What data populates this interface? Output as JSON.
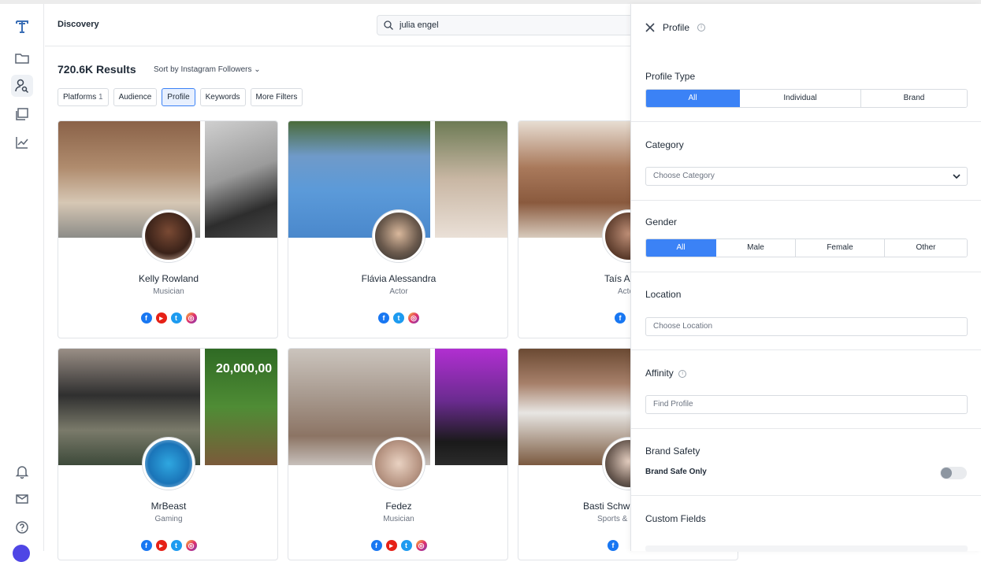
{
  "app": {
    "page_title": "Discovery",
    "search": {
      "value": "julia engel"
    }
  },
  "results": {
    "count_label": "720.6K Results",
    "sort_label": "Sort by Instagram Followers"
  },
  "filters": [
    {
      "label": "Platforms",
      "count": "1"
    },
    {
      "label": "Audience"
    },
    {
      "label": "Profile"
    },
    {
      "label": "Keywords"
    },
    {
      "label": "More Filters"
    }
  ],
  "cards": [
    {
      "name": "Kelly Rowland",
      "role": "Musician",
      "socials": [
        "facebook",
        "youtube",
        "twitter",
        "instagram"
      ]
    },
    {
      "name": "Flávia Alessandra",
      "role": "Actor",
      "socials": [
        "facebook",
        "twitter",
        "instagram"
      ]
    },
    {
      "name": "Taís Ar",
      "role": "Acto",
      "socials": [
        "facebook"
      ]
    },
    {
      "name": "MrBeast",
      "role": "Gaming",
      "socials": [
        "facebook",
        "youtube",
        "twitter",
        "instagram"
      ],
      "banner_text": "20,000,00"
    },
    {
      "name": "Fedez",
      "role": "Musician",
      "socials": [
        "facebook",
        "youtube",
        "twitter",
        "instagram"
      ]
    },
    {
      "name": "Basti Schw",
      "role": "Sports &",
      "socials": [
        "facebook"
      ]
    }
  ],
  "panel": {
    "title": "Profile",
    "profile_type": {
      "label": "Profile Type",
      "options": [
        "All",
        "Individual",
        "Brand"
      ],
      "selected": "All"
    },
    "category": {
      "label": "Category",
      "placeholder": "Choose Category"
    },
    "gender": {
      "label": "Gender",
      "options": [
        "All",
        "Male",
        "Female",
        "Other"
      ],
      "selected": "All"
    },
    "location": {
      "label": "Location",
      "placeholder": "Choose Location"
    },
    "affinity": {
      "label": "Affinity",
      "placeholder": "Find Profile"
    },
    "brand_safety": {
      "label": "Brand Safety",
      "toggle_label": "Brand Safe Only",
      "enabled": false
    },
    "custom_fields": {
      "label": "Custom Fields"
    }
  },
  "colors": {
    "accent": "#3b82f6",
    "border": "#d8dce1",
    "text": "#1f2a37"
  }
}
